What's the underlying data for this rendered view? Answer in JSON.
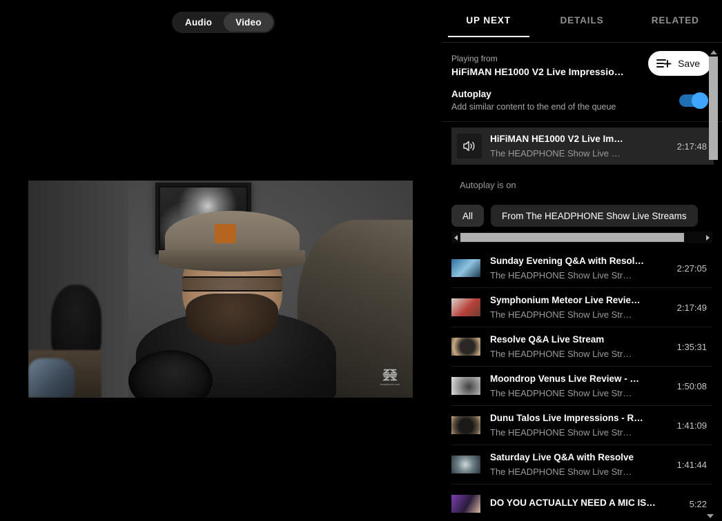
{
  "player": {
    "toggle": {
      "audio_label": "Audio",
      "video_label": "Video",
      "selected": "Video"
    },
    "watermark_text": "headphones.com"
  },
  "side_panel": {
    "tabs": [
      {
        "label": "UP NEXT",
        "active": true
      },
      {
        "label": "DETAILS",
        "active": false
      },
      {
        "label": "RELATED",
        "active": false
      }
    ],
    "playing_from": {
      "label": "Playing from",
      "title": "HiFiMAN HE1000 V2 Live Impressio…"
    },
    "save_button": {
      "label": "Save",
      "icon": "playlist-add-icon"
    },
    "autoplay": {
      "title": "Autoplay",
      "subtitle": "Add similar content to the end of the queue",
      "enabled": true,
      "accent_color": "#3ea6ff"
    },
    "current_item": {
      "icon": "speaker-icon",
      "title": "HiFiMAN HE1000 V2 Live Im…",
      "channel": "The HEADPHONE Show Live …",
      "duration": "2:17:48"
    },
    "autoplay_note": "Autoplay is on",
    "chips": [
      {
        "label": "All",
        "active": true
      },
      {
        "label": "From The HEADPHONE Show Live Streams",
        "active": false
      }
    ],
    "list": [
      {
        "title": "Sunday Evening Q&A with Resol…",
        "channel": "The HEADPHONE Show Live Str…",
        "duration": "2:27:05",
        "thumb_colors": [
          "#2f6f9e",
          "#8fc4e0",
          "#1d3b52"
        ]
      },
      {
        "title": "Symphonium Meteor Live Revie…",
        "channel": "The HEADPHONE Show Live Str…",
        "duration": "2:17:49",
        "thumb_colors": [
          "#d8d2cc",
          "#b8413a",
          "#6d3c32"
        ]
      },
      {
        "title": "Resolve Q&A Live Stream",
        "channel": "The HEADPHONE Show Live Str…",
        "duration": "1:35:31",
        "thumb_colors": [
          "#c6a782",
          "#2a2725",
          "#70604c"
        ]
      },
      {
        "title": "Moondrop Venus Live Review - …",
        "channel": "The HEADPHONE Show Live Str…",
        "duration": "1:50:08",
        "thumb_colors": [
          "#e3e3e3",
          "#404040",
          "#8d8d8d"
        ]
      },
      {
        "title": "Dunu Talos Live Impressions - R…",
        "channel": "The HEADPHONE Show Live Str…",
        "duration": "1:41:09",
        "thumb_colors": [
          "#c8ae8b",
          "#1c1a18",
          "#5d513f"
        ]
      },
      {
        "title": "Saturday Live Q&A with Resolve",
        "channel": "The HEADPHONE Show Live Str…",
        "duration": "1:41:44",
        "thumb_colors": [
          "#6d7f86",
          "#cfd8d8",
          "#2b3338"
        ]
      },
      {
        "title": "DO YOU ACTUALLY NEED A MIC IS…",
        "channel": "",
        "duration": "5:22",
        "thumb_colors": [
          "#7a3fb0",
          "#d9b8a2",
          "#2b1c3c"
        ]
      }
    ]
  }
}
